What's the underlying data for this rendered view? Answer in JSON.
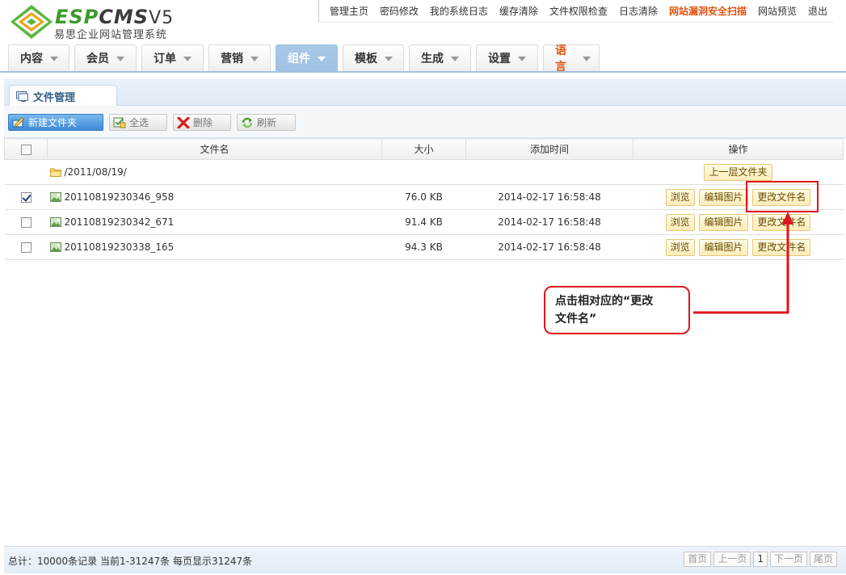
{
  "brand": {
    "name_a": "ESP",
    "name_b": "CMS",
    "version": "V5",
    "subtitle": "易思企业网站管理系统"
  },
  "topnav": [
    "管理主页",
    "密码修改",
    "我的系统日志",
    "缓存清除",
    "文件权限检查",
    "日志清除",
    "网站漏洞安全扫描",
    "网站预览",
    "退出"
  ],
  "mainnav": [
    "内容",
    "会员",
    "订单",
    "营销",
    "组件",
    "模板",
    "生成",
    "设置",
    "语言"
  ],
  "panel": {
    "tab_label": "文件管理"
  },
  "toolbar": {
    "new_folder": "新建文件夹",
    "select_all": "全选",
    "delete": "删除",
    "refresh": "刷新"
  },
  "table": {
    "headers": {
      "name": "文件名",
      "size": "大小",
      "time": "添加时间",
      "ops": "操作"
    },
    "folder_row": {
      "path": "/2011/08/19/",
      "up_button": "上一层文件夹"
    },
    "rows": [
      {
        "name": "20110819230346_958",
        "size": "76.0 KB",
        "time": "2014-02-17 16:58:48",
        "checked": true
      },
      {
        "name": "20110819230342_671",
        "size": "91.4 KB",
        "time": "2014-02-17 16:58:48",
        "checked": false
      },
      {
        "name": "20110819230338_165",
        "size": "94.3 KB",
        "time": "2014-02-17 16:58:48",
        "checked": false
      }
    ],
    "row_actions": {
      "browse": "浏览",
      "edit_image": "编辑图片",
      "rename": "更改文件名"
    }
  },
  "annotation": {
    "line1": "点击相对应的“更改",
    "line2": "文件名”",
    "color": "#e0141c"
  },
  "footer": {
    "summary": "总计：10000条记录 当前1-31247条 每页显示31247条",
    "pager": {
      "first": "首页",
      "prev": "上一页",
      "current": "1",
      "next": "下一页",
      "last": "尾页"
    }
  }
}
